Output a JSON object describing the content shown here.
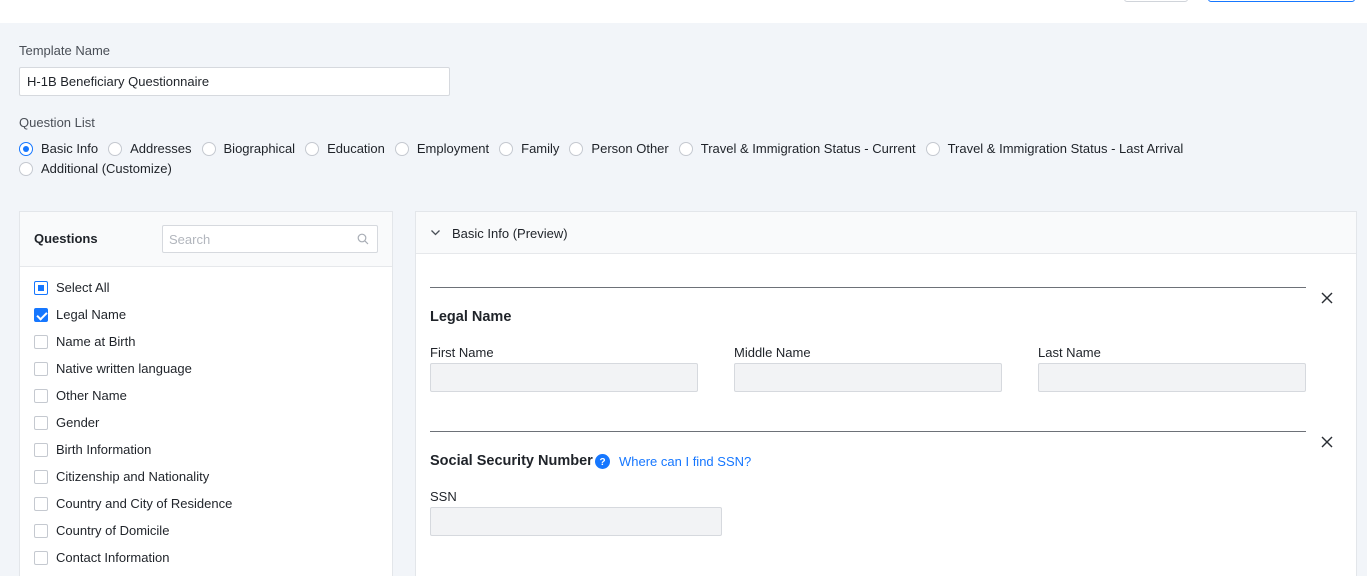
{
  "template": {
    "name_label": "Template Name",
    "name_value": "H-1B Beneficiary Questionnaire"
  },
  "question_list": {
    "label": "Question List",
    "options": [
      {
        "label": "Basic Info",
        "selected": true
      },
      {
        "label": "Addresses",
        "selected": false
      },
      {
        "label": "Biographical",
        "selected": false
      },
      {
        "label": "Education",
        "selected": false
      },
      {
        "label": "Employment",
        "selected": false
      },
      {
        "label": "Family",
        "selected": false
      },
      {
        "label": "Person Other",
        "selected": false
      },
      {
        "label": "Travel & Immigration Status - Current",
        "selected": false
      },
      {
        "label": "Travel & Immigration Status - Last Arrival",
        "selected": false
      },
      {
        "label": "Additional (Customize)",
        "selected": false
      }
    ]
  },
  "questions": {
    "title": "Questions",
    "search_placeholder": "Search",
    "items": [
      {
        "label": "Select All",
        "state": "partial"
      },
      {
        "label": "Legal Name",
        "state": "checked"
      },
      {
        "label": "Name at Birth",
        "state": "unchecked"
      },
      {
        "label": "Native written language",
        "state": "unchecked"
      },
      {
        "label": "Other Name",
        "state": "unchecked"
      },
      {
        "label": "Gender",
        "state": "unchecked"
      },
      {
        "label": "Birth Information",
        "state": "unchecked"
      },
      {
        "label": "Citizenship and Nationality",
        "state": "unchecked"
      },
      {
        "label": "Country and City of Residence",
        "state": "unchecked"
      },
      {
        "label": "Country of Domicile",
        "state": "unchecked"
      },
      {
        "label": "Contact Information",
        "state": "unchecked"
      }
    ]
  },
  "preview": {
    "title": "Basic Info (Preview)",
    "legal_name": {
      "title": "Legal Name",
      "first_label": "First Name",
      "middle_label": "Middle Name",
      "last_label": "Last Name"
    },
    "ssn": {
      "title": "Social Security Number",
      "help_link": "Where can I find SSN?",
      "field_label": "SSN"
    }
  },
  "colors": {
    "accent": "#1677ff",
    "background": "#f2f5f9",
    "input_disabled": "#f2f3f5"
  }
}
